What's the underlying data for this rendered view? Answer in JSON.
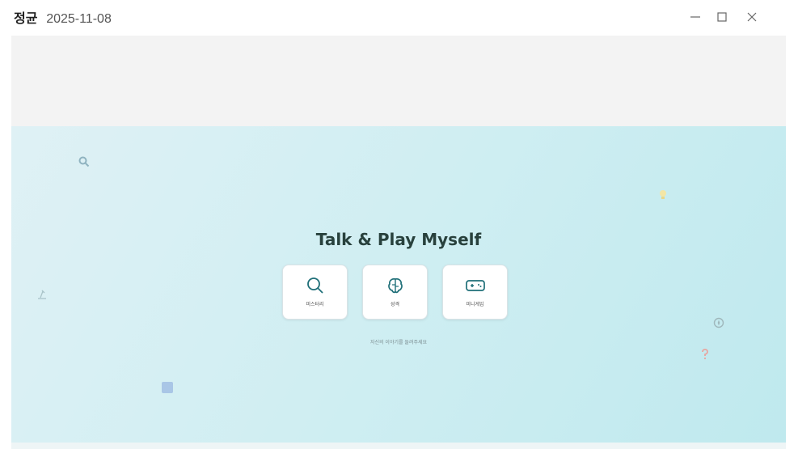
{
  "window": {
    "title_name": "정균",
    "title_date": "2025-11-08"
  },
  "hero": {
    "title": "Talk & Play Myself",
    "hint": "자신의 이야기를 들려주세요",
    "cards": [
      {
        "label": "미스터리",
        "icon": "magnifier-icon"
      },
      {
        "label": "성격",
        "icon": "brain-icon"
      },
      {
        "label": "미니게임",
        "icon": "gamepad-icon"
      }
    ],
    "decorations": [
      "magnifier-icon",
      "lightbulb-icon",
      "microscope-icon",
      "compass-icon",
      "question-mark-icon",
      "note-square-icon"
    ]
  },
  "colors": {
    "accent": "#1f6f78",
    "title_text": "#28413d",
    "hero_bg_start": "#dff1f5",
    "hero_bg_end": "#bfe9ee"
  }
}
